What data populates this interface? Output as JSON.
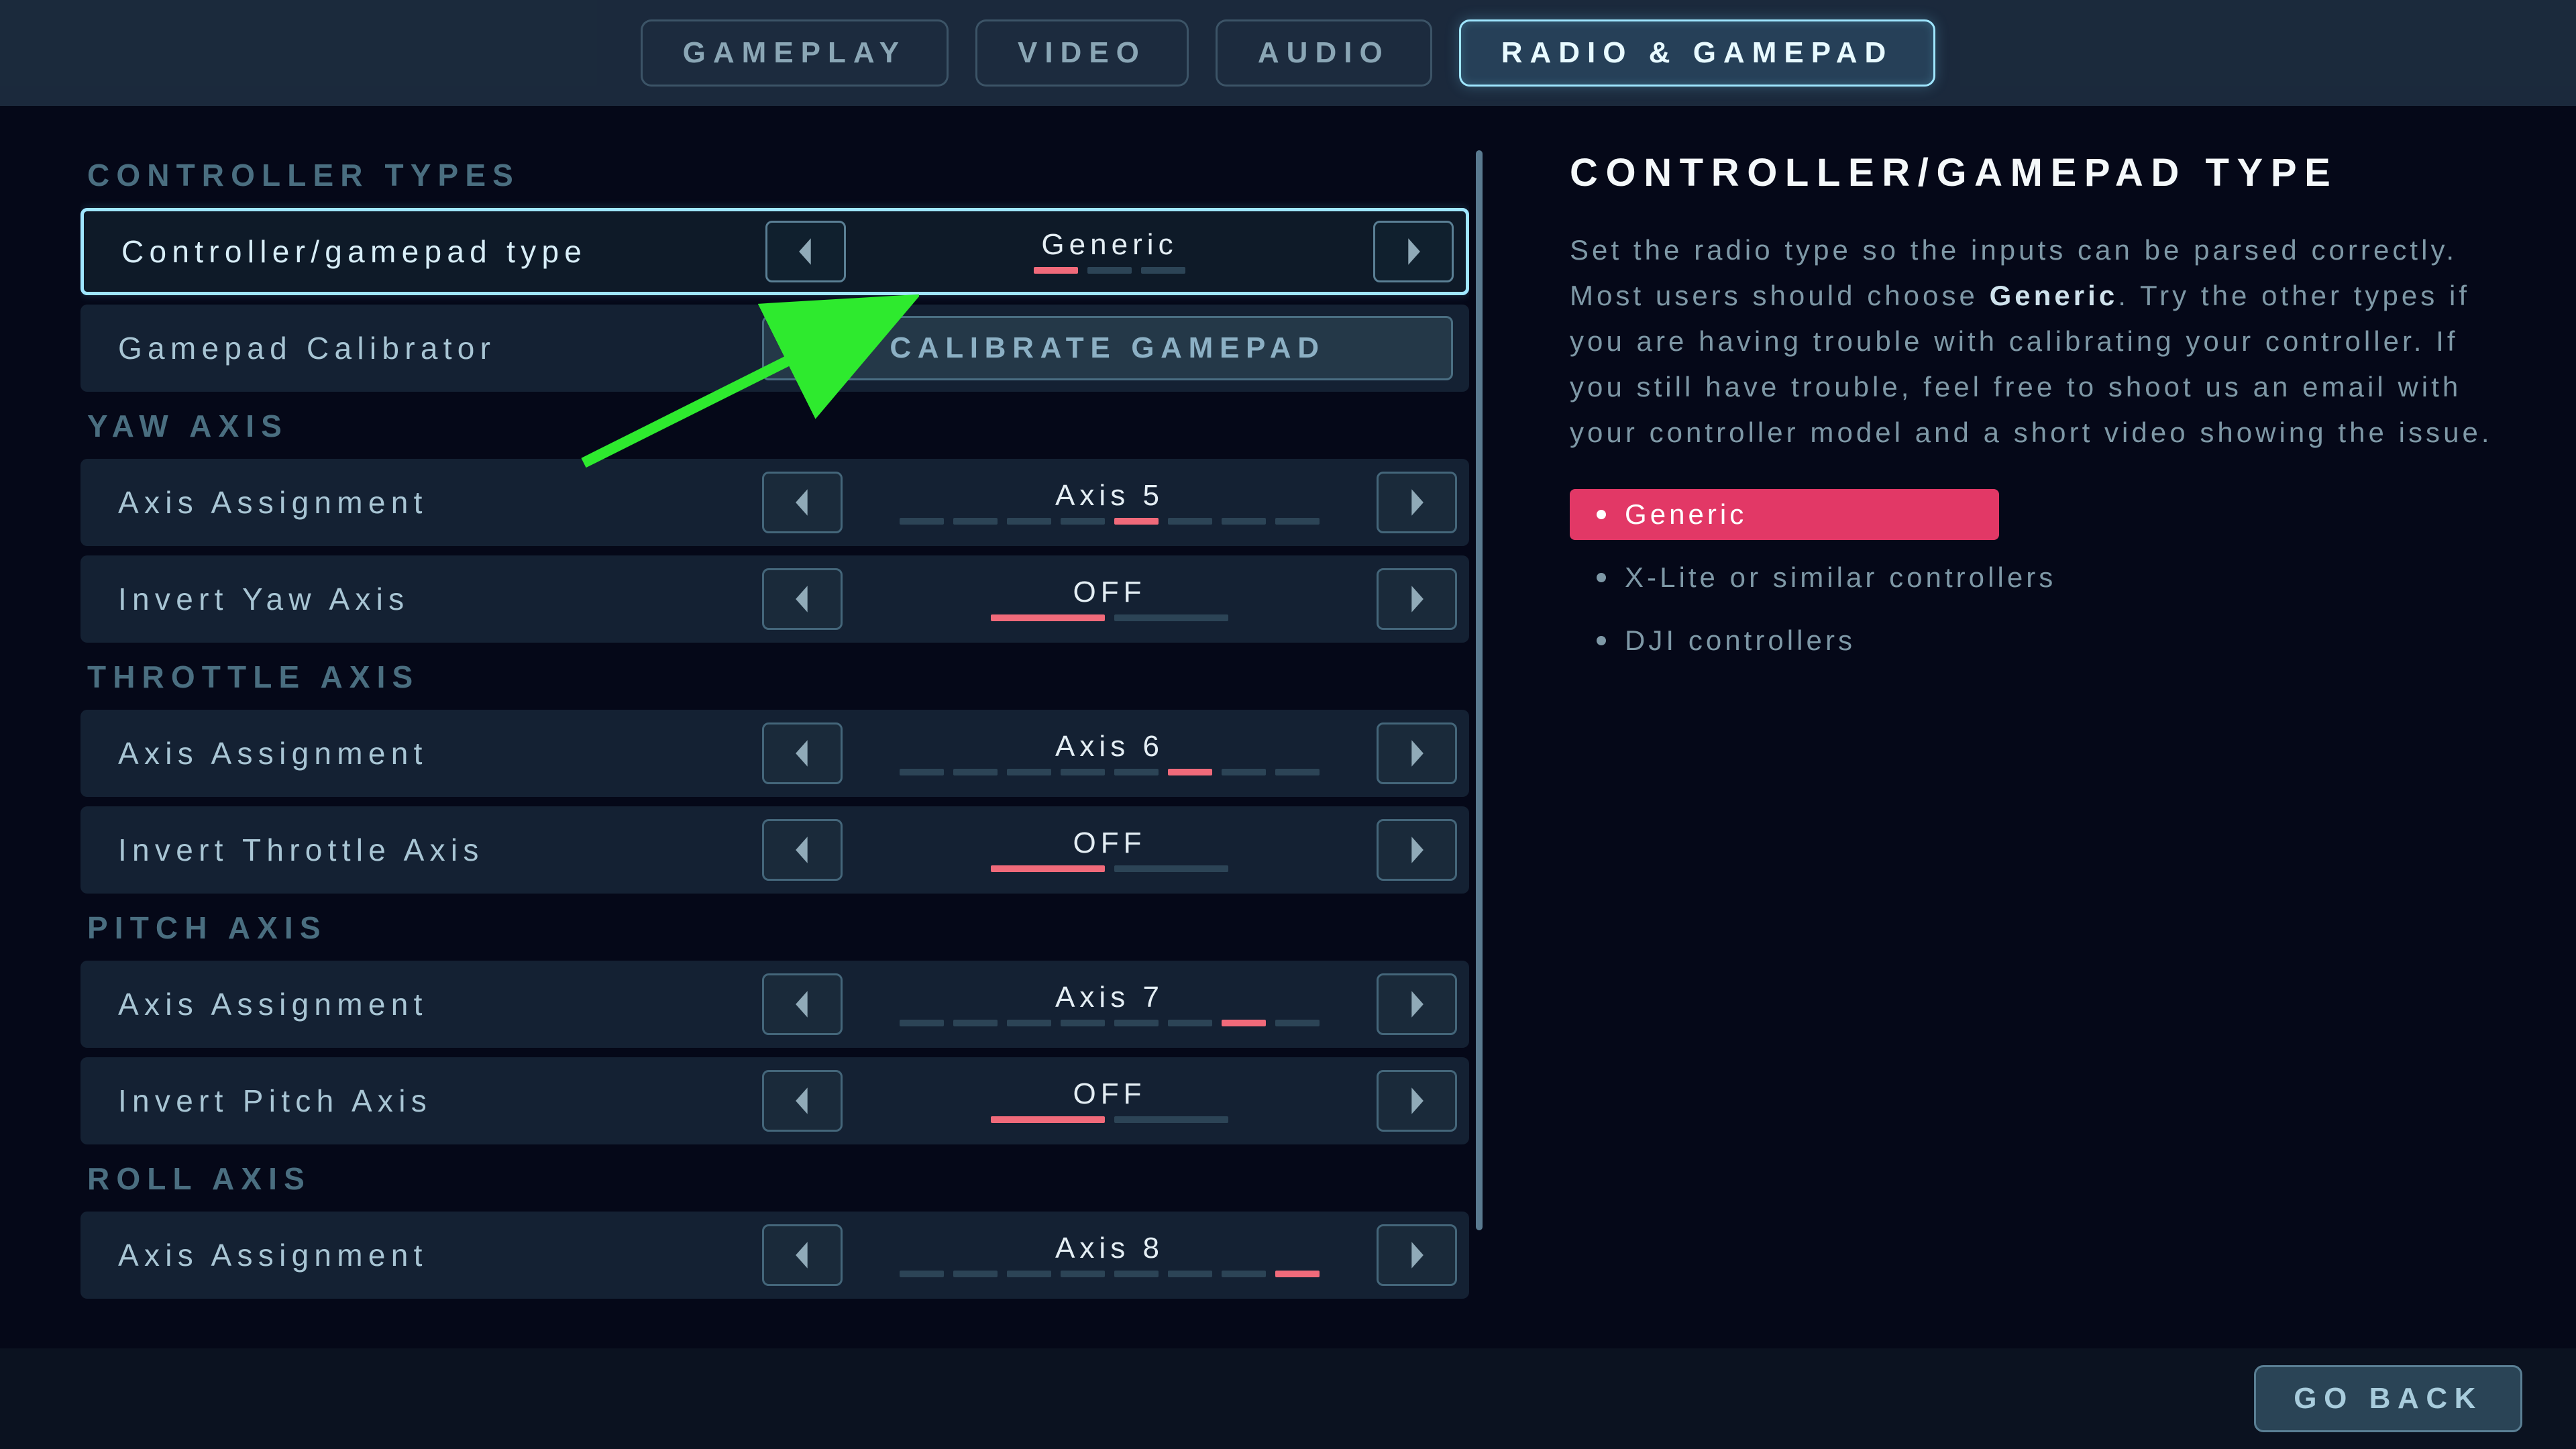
{
  "tabs": [
    {
      "label": "GAMEPLAY",
      "active": false
    },
    {
      "label": "VIDEO",
      "active": false
    },
    {
      "label": "AUDIO",
      "active": false
    },
    {
      "label": "RADIO & GAMEPAD",
      "active": true
    }
  ],
  "sections": {
    "controller_types": {
      "header": "CONTROLLER TYPES",
      "type_row": {
        "label": "Controller/gamepad type",
        "value": "Generic",
        "ticks_total": 3,
        "ticks_on_index": 0
      },
      "calibrator_row": {
        "label": "Gamepad Calibrator",
        "button": "CALIBRATE GAMEPAD"
      }
    },
    "yaw": {
      "header": "YAW AXIS",
      "assign": {
        "label": "Axis Assignment",
        "value": "Axis 5",
        "ticks_total": 8,
        "ticks_on_index": 4
      },
      "invert": {
        "label": "Invert Yaw Axis",
        "value": "OFF",
        "on": false
      }
    },
    "throttle": {
      "header": "THROTTLE AXIS",
      "assign": {
        "label": "Axis Assignment",
        "value": "Axis 6",
        "ticks_total": 8,
        "ticks_on_index": 5
      },
      "invert": {
        "label": "Invert Throttle Axis",
        "value": "OFF",
        "on": false
      }
    },
    "pitch": {
      "header": "PITCH AXIS",
      "assign": {
        "label": "Axis Assignment",
        "value": "Axis 7",
        "ticks_total": 8,
        "ticks_on_index": 6
      },
      "invert": {
        "label": "Invert Pitch Axis",
        "value": "OFF",
        "on": false
      }
    },
    "roll": {
      "header": "ROLL AXIS",
      "assign": {
        "label": "Axis Assignment",
        "value": "Axis 8",
        "ticks_total": 8,
        "ticks_on_index": 7
      }
    }
  },
  "detail": {
    "title": "CONTROLLER/GAMEPAD TYPE",
    "body_pre": "Set the radio type so the inputs can be parsed correctly. Most users should choose ",
    "body_bold": "Generic",
    "body_post": ". Try the other types if you are having trouble with calibrating your controller. If you still have trouble, feel free to shoot us an email with your controller model and a short video showing the issue.",
    "options": [
      {
        "label": "Generic",
        "active": true
      },
      {
        "label": "X-Lite or similar controllers",
        "active": false
      },
      {
        "label": "DJI controllers",
        "active": false
      }
    ]
  },
  "footer": {
    "goback": "GO BACK"
  }
}
